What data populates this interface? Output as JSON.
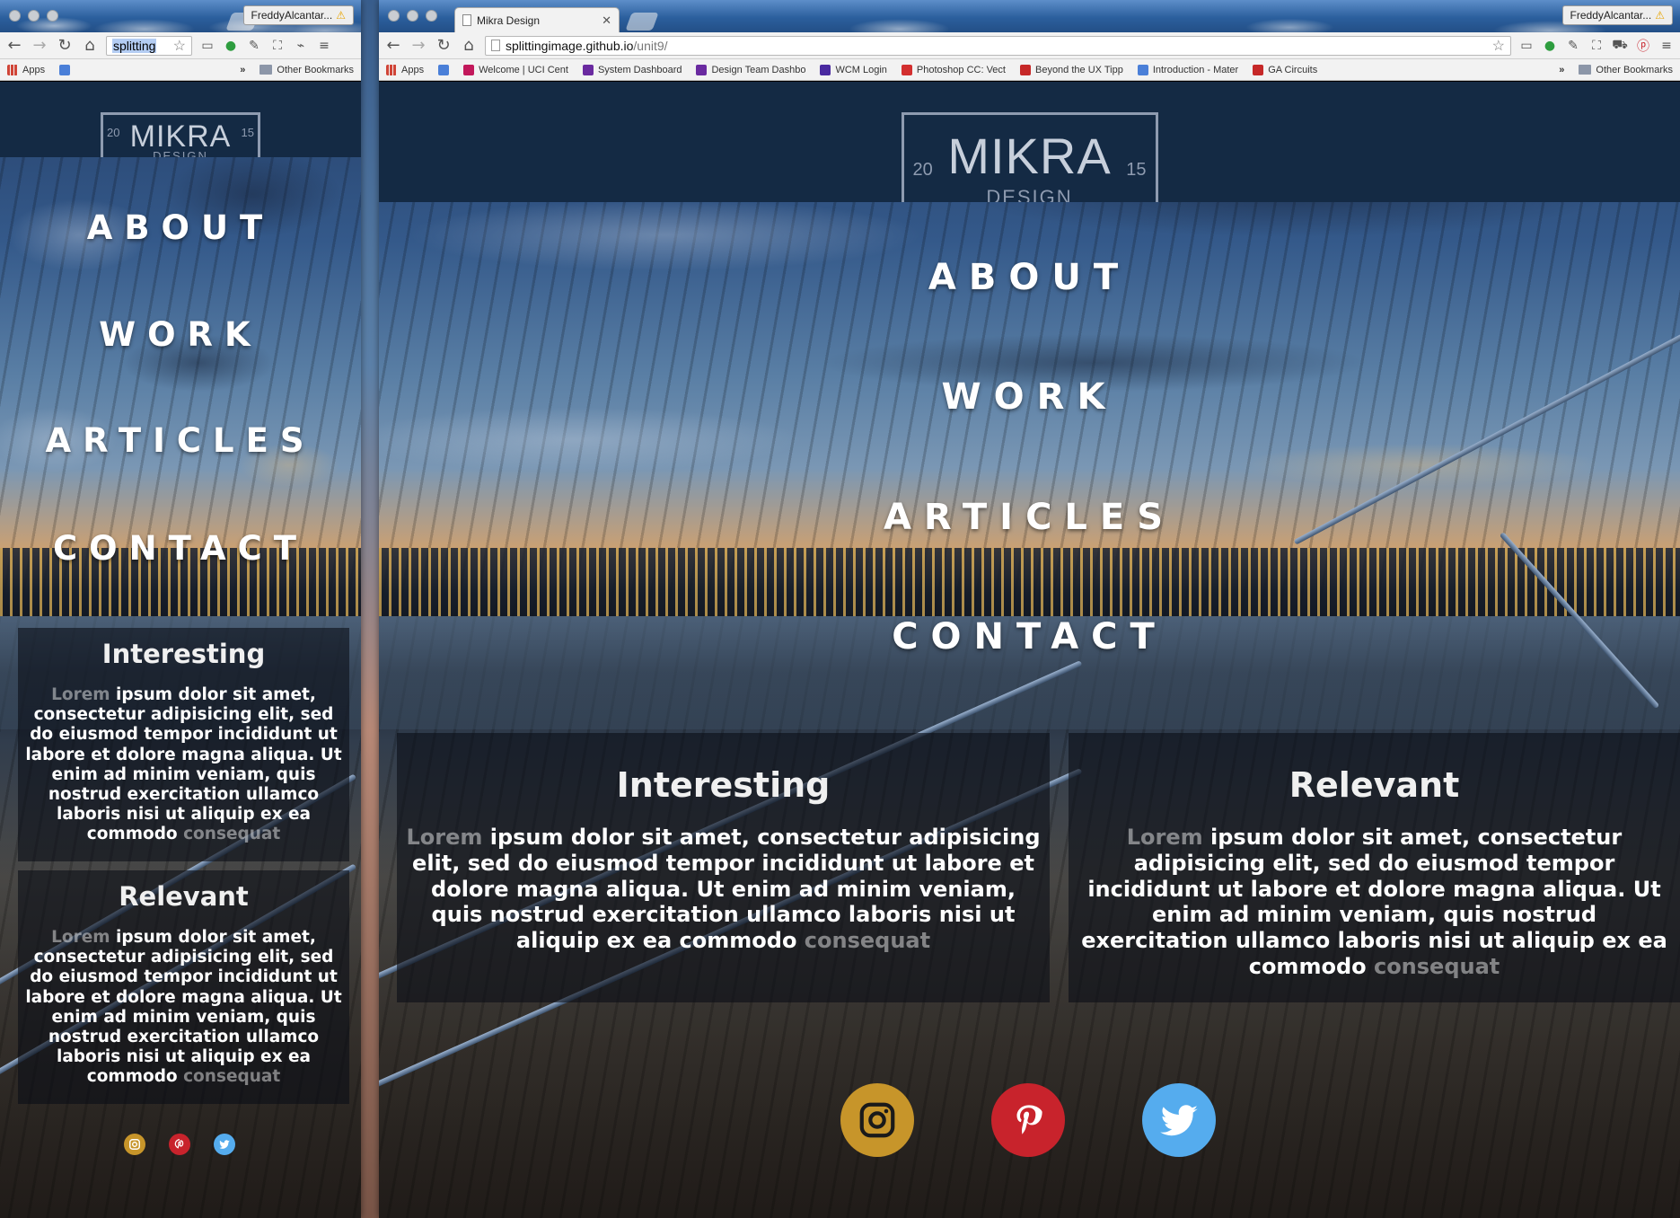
{
  "colors": {
    "instagram": "#c7952a",
    "pinterest": "#c8232c",
    "twitter": "#55acee",
    "header_bg": "#142a44"
  },
  "browser": {
    "profile_name": "FreddyAlcantar...",
    "left_url": "splitting",
    "right_tab_title": "Mikra Design",
    "right_url_host": "splittingimage.github.io",
    "right_url_path": "/unit9/",
    "bookmarks_left": {
      "apps": "Apps",
      "more": "»",
      "other": "Other Bookmarks"
    },
    "bookmarks_right": [
      {
        "label": "Apps",
        "icon": "apps-icon",
        "color": "#d04437"
      },
      {
        "label": "",
        "icon": "google-icon",
        "color": "#4a7fd8"
      },
      {
        "label": "Welcome | UCI Cent",
        "icon": "uci-icon",
        "color": "#c2185b"
      },
      {
        "label": "System Dashboard",
        "icon": "jira-icon",
        "color": "#6a2aa0"
      },
      {
        "label": "Design Team Dashbo",
        "icon": "jira-icon",
        "color": "#6a2aa0"
      },
      {
        "label": "WCM Login",
        "icon": "wcm-icon",
        "color": "#4a2aa0"
      },
      {
        "label": "Photoshop CC: Vect",
        "icon": "youtube-icon",
        "color": "#d32f2f"
      },
      {
        "label": "Beyond the UX Tipp",
        "icon": "star-icon",
        "color": "#c62828"
      },
      {
        "label": "Introduction - Mater",
        "icon": "google-icon",
        "color": "#4a7fd8"
      },
      {
        "label": "GA Circuits",
        "icon": "ga-icon",
        "color": "#c62828"
      }
    ],
    "bookmarks_more": "»",
    "other_bookmarks": "Other Bookmarks"
  },
  "page": {
    "logo": {
      "main": "MIKRA",
      "year_left": "20",
      "year_right": "15",
      "sub": "DESIGN"
    },
    "nav": [
      "ABOUT",
      "WORK",
      "ARTICLES",
      "CONTACT"
    ],
    "cards": [
      {
        "title": "Interesting",
        "body_start": "Lorem",
        "body_main": " ipsum dolor sit amet, consectetur adipisicing elit, sed do eiusmod tempor incididunt ut labore et dolore magna aliqua. Ut enim ad minim veniam, quis nostrud exercitation ullamco laboris nisi ut aliquip ex ea commodo ",
        "body_end": "consequat"
      },
      {
        "title": "Relevant",
        "body_start": "Lorem",
        "body_main": " ipsum dolor sit amet, consectetur adipisicing elit, sed do eiusmod tempor incididunt ut labore et dolore magna aliqua. Ut enim ad minim veniam, quis nostrud exercitation ullamco laboris nisi ut aliquip ex ea commodo ",
        "body_end": "consequat"
      }
    ],
    "social": [
      "instagram-icon",
      "pinterest-icon",
      "twitter-icon"
    ]
  }
}
